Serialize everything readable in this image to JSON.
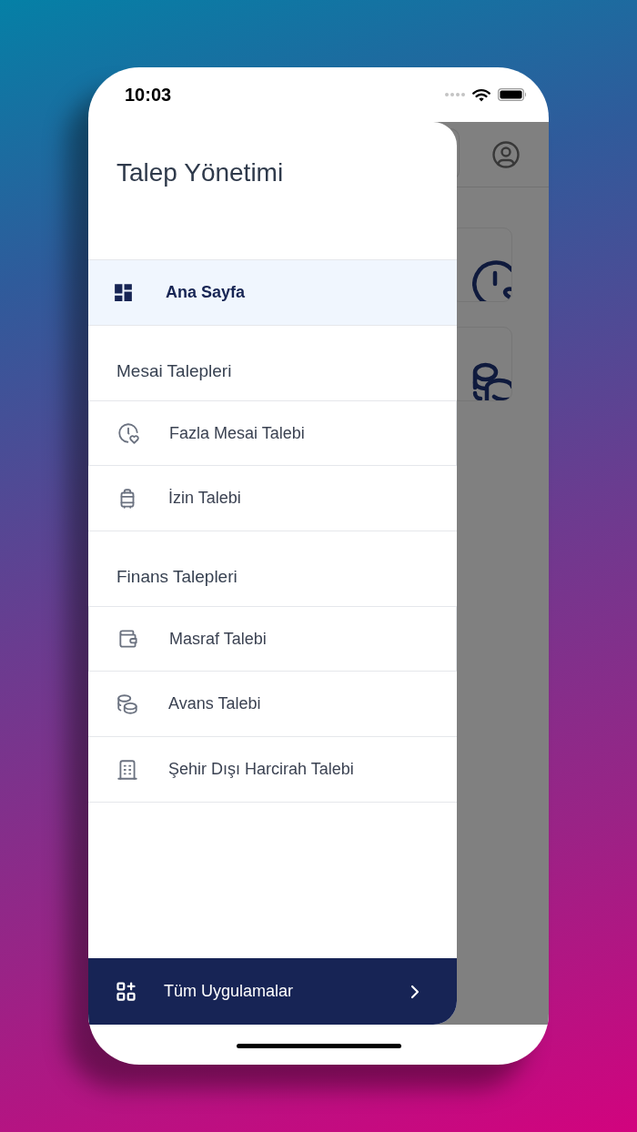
{
  "status_bar": {
    "time": "10:03"
  },
  "drawer": {
    "title": "Talep Yönetimi",
    "home_item": {
      "label": "Ana Sayfa",
      "selected": true
    },
    "sections": [
      {
        "title": "Mesai Talepleri",
        "items": [
          {
            "label": "Fazla Mesai Talebi",
            "selected": false
          },
          {
            "label": "İzin Talebi",
            "selected": false
          }
        ]
      },
      {
        "title": "Finans Talepleri",
        "items": [
          {
            "label": "Masraf Talebi",
            "selected": false
          },
          {
            "label": "Avans Talebi",
            "selected": false
          },
          {
            "label": "Şehir Dışı Harcirah Talebi",
            "selected": false
          }
        ]
      }
    ],
    "footer_button": {
      "label": "Tüm Uygulamalar"
    }
  }
}
